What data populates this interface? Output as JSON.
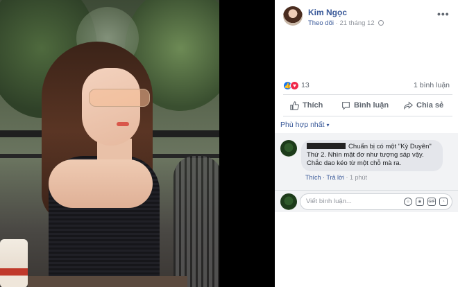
{
  "post": {
    "author": "Kim Ngọc",
    "follow_label": "Theo dõi",
    "separator": "·",
    "timestamp": "21 tháng 12",
    "more_icon": "•••"
  },
  "reactions": {
    "count": "13",
    "comments_count": "1 bình luận",
    "like_icon": "👍",
    "love_icon": "♥"
  },
  "actions": {
    "like": "Thích",
    "comment": "Bình luận",
    "share": "Chia sẻ"
  },
  "sort": {
    "label": "Phù hợp nhất",
    "caret": "▾"
  },
  "comment": {
    "text_line1": "Chuẩn bị có một \"Kỳ Duyên\"",
    "text_line2": "Thứ 2. Nhìn mặt đơ như tượng sáp vậy.",
    "text_line3": "Chắc dao kéo từ một chỗ mà ra.",
    "like_label": "Thích",
    "reply_label": "Trả lời",
    "dot": "·",
    "time": "1 phút"
  },
  "composer": {
    "placeholder": "Viết bình luận...",
    "icons": [
      "emoji-icon",
      "camera-icon",
      "gif-icon",
      "sticker-icon"
    ],
    "gif_text": "GIF"
  }
}
